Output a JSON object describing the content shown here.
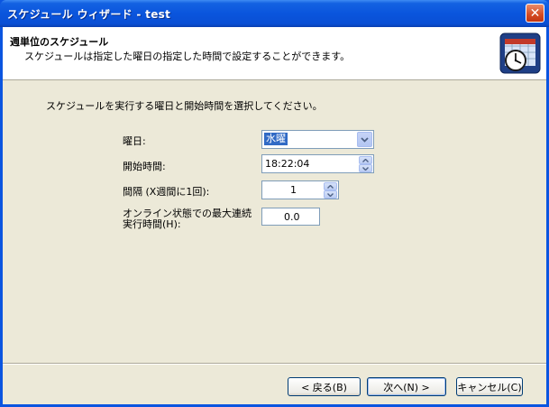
{
  "window": {
    "title": "スケジュール ウィザード - test",
    "close_symbol": "✕"
  },
  "header": {
    "title": "週単位のスケジュール",
    "subtitle": "スケジュールは指定した曜日の指定した時間で設定することができます。",
    "icon": "calendar-clock-icon"
  },
  "body": {
    "instruction": "スケジュールを実行する曜日と開始時間を選択してください。",
    "fields": {
      "weekday": {
        "label": "曜日:",
        "value": "水曜"
      },
      "start_time": {
        "label": "開始時間:",
        "value": "18:22:04"
      },
      "interval": {
        "label": "間隔 (X週間に1回):",
        "value": "1"
      },
      "max_time": {
        "label_line1": "オンライン状態での最大連続",
        "label_line2": "実行時間(H):",
        "value": "0.0"
      }
    }
  },
  "buttons": {
    "back": "< 戻る(B)",
    "next": "次へ(N) >",
    "cancel": "キャンセル(C)"
  },
  "colors": {
    "titlebar": "#0a55dd",
    "selection": "#316ac5",
    "dialog_bg": "#ece9d8"
  }
}
